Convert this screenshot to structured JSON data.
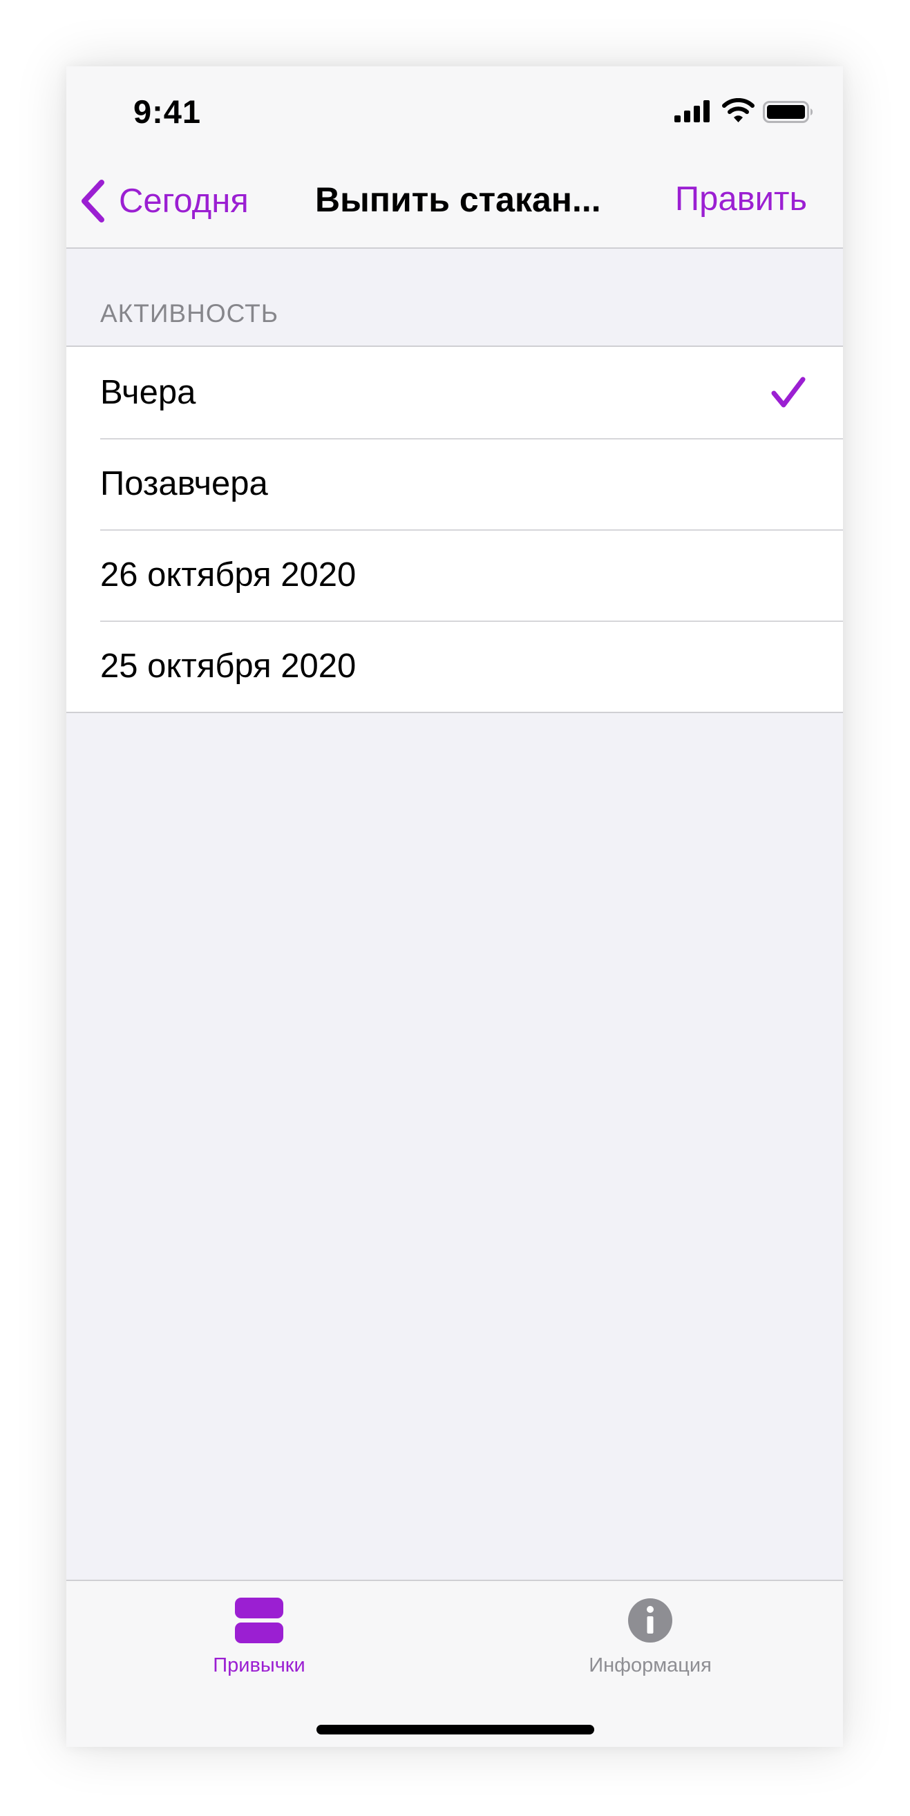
{
  "status_bar": {
    "time": "9:41",
    "icons": [
      "cellular-signal-icon",
      "wifi-icon",
      "battery-icon"
    ]
  },
  "nav_bar": {
    "back_label": "Сегодня",
    "back_icon": "chevron-left-icon",
    "title": "Выпить стакан...",
    "edit_label": "Править"
  },
  "section": {
    "header": "АКТИВНОСТЬ",
    "items": [
      {
        "label": "Вчера",
        "checked": true
      },
      {
        "label": "Позавчера",
        "checked": false
      },
      {
        "label": "26 октября 2020",
        "checked": false
      },
      {
        "label": "25 октября 2020",
        "checked": false
      }
    ]
  },
  "tab_bar": {
    "tabs": [
      {
        "label": "Привычки",
        "icon": "habits-icon",
        "selected": true
      },
      {
        "label": "Информация",
        "icon": "info-icon",
        "selected": false
      }
    ]
  },
  "colors": {
    "accent": "#9b1fd2",
    "background": "#f2f2f7",
    "bar_background": "#f7f7f8",
    "secondary_text": "#8e8e93",
    "separator": "#cfcfd3"
  }
}
